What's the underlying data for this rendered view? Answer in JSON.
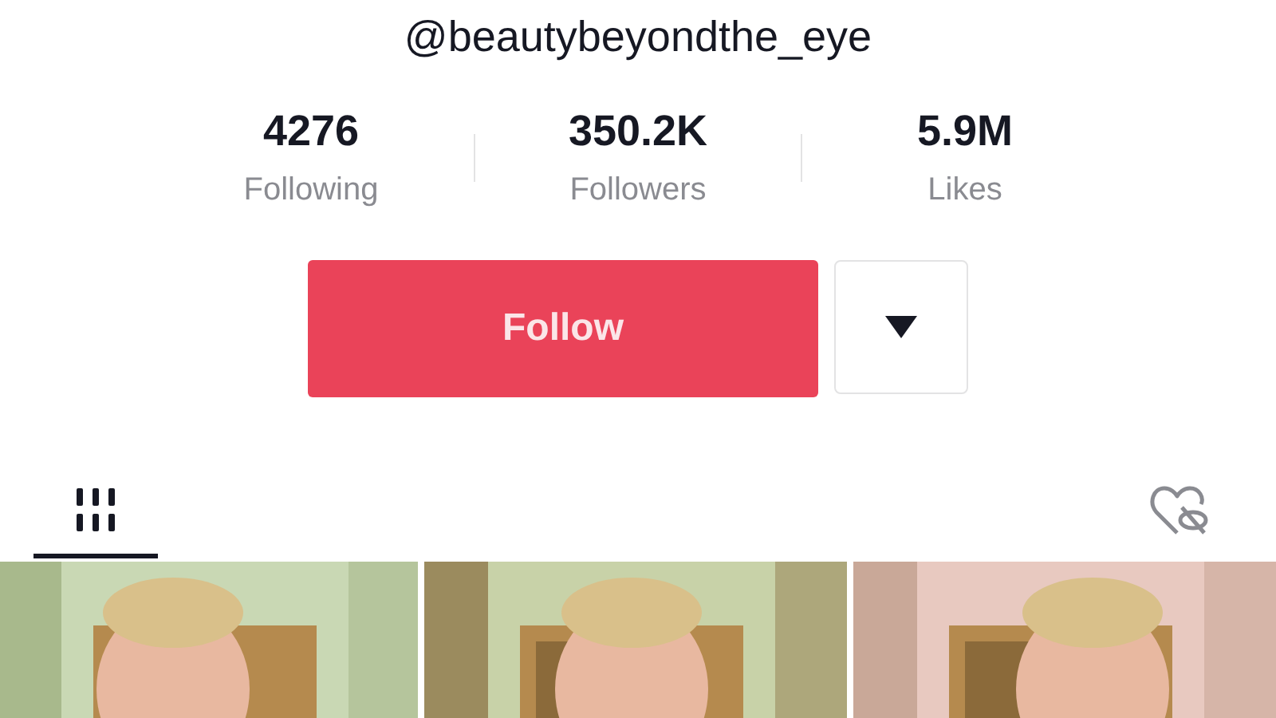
{
  "profile": {
    "username": "@beautybeyondthe_eye"
  },
  "stats": [
    {
      "value": "4276",
      "label": "Following"
    },
    {
      "value": "350.2K",
      "label": "Followers"
    },
    {
      "value": "5.9M",
      "label": "Likes"
    }
  ],
  "actions": {
    "follow": "Follow"
  },
  "tabs": [
    {
      "kind": "videos",
      "selected": true
    },
    {
      "kind": "liked",
      "selected": false
    }
  ]
}
